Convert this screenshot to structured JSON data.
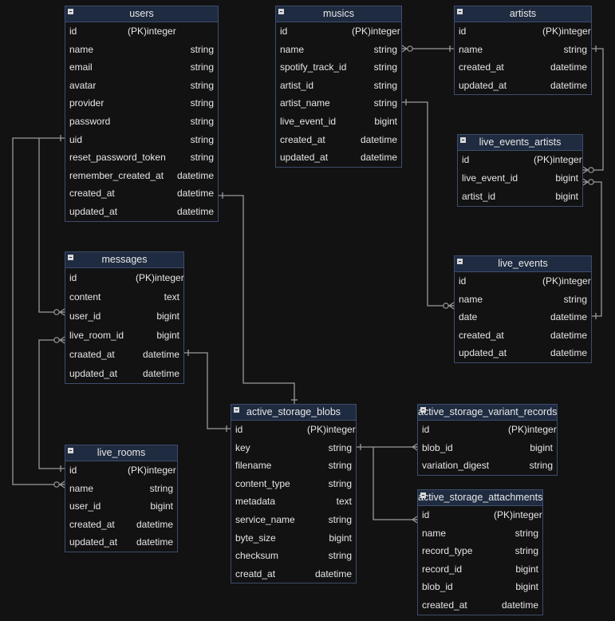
{
  "tables": {
    "users": {
      "title": "users",
      "fields": [
        {
          "name": "id",
          "type": "(PK)integer"
        },
        {
          "name": "name",
          "type": "string"
        },
        {
          "name": "email",
          "type": "string"
        },
        {
          "name": "avatar",
          "type": "string"
        },
        {
          "name": "provider",
          "type": "string"
        },
        {
          "name": "password",
          "type": "string"
        },
        {
          "name": "uid",
          "type": "string"
        },
        {
          "name": "reset_password_token",
          "type": "string"
        },
        {
          "name": "remember_created_at",
          "type": "datetime"
        },
        {
          "name": "created_at",
          "type": "datetime"
        },
        {
          "name": "updated_at",
          "type": "datetime"
        }
      ]
    },
    "musics": {
      "title": "musics",
      "fields": [
        {
          "name": "id",
          "type": "(PK)integer"
        },
        {
          "name": "name",
          "type": "string"
        },
        {
          "name": "spotify_track_id",
          "type": "string"
        },
        {
          "name": "artist_id",
          "type": "string"
        },
        {
          "name": "artist_name",
          "type": "string"
        },
        {
          "name": "live_event_id",
          "type": "bigint"
        },
        {
          "name": "created_at",
          "type": "datetime"
        },
        {
          "name": "updated_at",
          "type": "datetime"
        }
      ]
    },
    "artists": {
      "title": "artists",
      "fields": [
        {
          "name": "id",
          "type": "(PK)integer"
        },
        {
          "name": "name",
          "type": "string"
        },
        {
          "name": "created_at",
          "type": "datetime"
        },
        {
          "name": "updated_at",
          "type": "datetime"
        }
      ]
    },
    "live_events_artists": {
      "title": "live_events_artists",
      "fields": [
        {
          "name": "id",
          "type": "(PK)integer"
        },
        {
          "name": "live_event_id",
          "type": "bigint"
        },
        {
          "name": "artist_id",
          "type": "bigint"
        }
      ]
    },
    "live_events": {
      "title": "live_events",
      "fields": [
        {
          "name": "id",
          "type": "(PK)integer"
        },
        {
          "name": "name",
          "type": "string"
        },
        {
          "name": "date",
          "type": "datetime"
        },
        {
          "name": "created_at",
          "type": "datetime"
        },
        {
          "name": "updated_at",
          "type": "datetime"
        }
      ]
    },
    "messages": {
      "title": "messages",
      "fields": [
        {
          "name": "id",
          "type": "(PK)integer"
        },
        {
          "name": "content",
          "type": "text"
        },
        {
          "name": "user_id",
          "type": "bigint"
        },
        {
          "name": "live_room_id",
          "type": "bigint"
        },
        {
          "name": "craated_at",
          "type": "datetime"
        },
        {
          "name": "updated_at",
          "type": "datetime"
        }
      ]
    },
    "live_rooms": {
      "title": "live_rooms",
      "fields": [
        {
          "name": "id",
          "type": "(PK)integer"
        },
        {
          "name": "name",
          "type": "string"
        },
        {
          "name": "user_id",
          "type": "bigint"
        },
        {
          "name": "created_at",
          "type": "datetime"
        },
        {
          "name": "updated_at",
          "type": "datetime"
        }
      ]
    },
    "active_storage_blobs": {
      "title": "active_storage_blobs",
      "fields": [
        {
          "name": "id",
          "type": "(PK)integer"
        },
        {
          "name": "key",
          "type": "string"
        },
        {
          "name": "filename",
          "type": "string"
        },
        {
          "name": "content_type",
          "type": "string"
        },
        {
          "name": "metadata",
          "type": "text"
        },
        {
          "name": "service_name",
          "type": "string"
        },
        {
          "name": "byte_size",
          "type": "bigint"
        },
        {
          "name": "checksum",
          "type": "string"
        },
        {
          "name": "creatd_at",
          "type": "datetime"
        }
      ]
    },
    "active_storage_variant_records": {
      "title": "active_storage_variant_records",
      "fields": [
        {
          "name": "id",
          "type": "(PK)integer"
        },
        {
          "name": "blob_id",
          "type": "bigint"
        },
        {
          "name": "variation_digest",
          "type": "string"
        }
      ]
    },
    "active_storage_attachments": {
      "title": "active_storage_attachments",
      "fields": [
        {
          "name": "id",
          "type": "(PK)integer"
        },
        {
          "name": "name",
          "type": "string"
        },
        {
          "name": "record_type",
          "type": "string"
        },
        {
          "name": "record_id",
          "type": "bigint"
        },
        {
          "name": "blob_id",
          "type": "bigint"
        },
        {
          "name": "created_at",
          "type": "datetime"
        }
      ]
    }
  },
  "colors": {
    "background": "#121213",
    "header": "#1f2b40",
    "border": "#3d4d6b",
    "line": "#9a9a9a",
    "text": "#e6e6e6"
  }
}
